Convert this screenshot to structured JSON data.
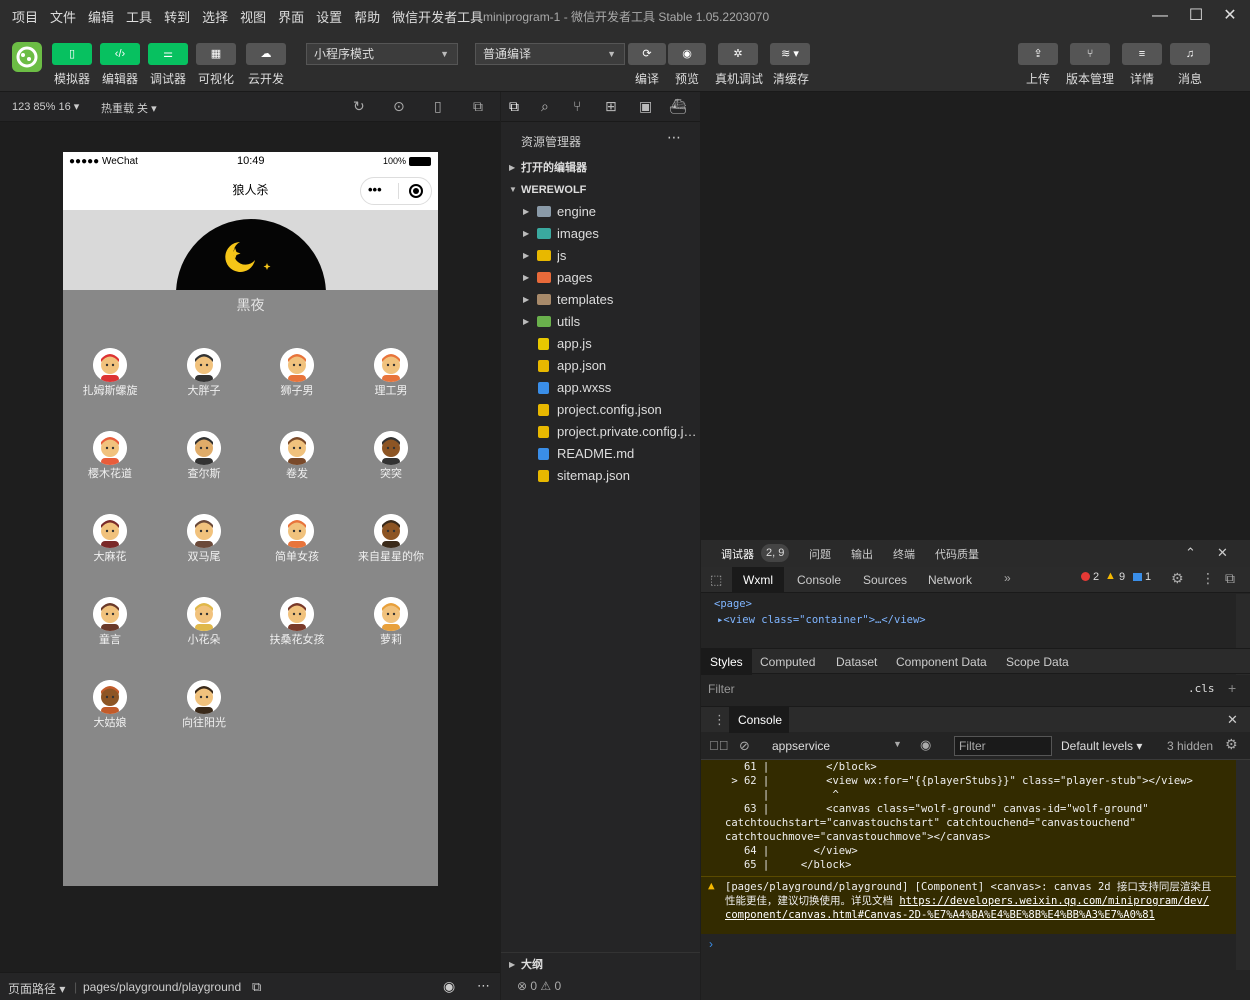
{
  "menu": [
    "项目",
    "文件",
    "编辑",
    "工具",
    "转到",
    "选择",
    "视图",
    "界面",
    "设置",
    "帮助",
    "微信开发者工具"
  ],
  "window_title": "miniprogram-1 - 微信开发者工具 Stable 1.05.2203070",
  "toolbar": {
    "simulator": "模拟器",
    "editor": "编辑器",
    "debugger": "调试器",
    "visual": "可视化",
    "cloud": "云开发",
    "mode": "小程序模式",
    "compile_mode": "普通编译",
    "compile": "编译",
    "preview": "预览",
    "remote_debug": "真机调试",
    "clear_cache": "清缓存",
    "upload": "上传",
    "version": "版本管理",
    "details": "详情",
    "messages": "消息"
  },
  "simbar": {
    "zoom": "123 85% 16 ▾",
    "hotreload": "热重载 关 ▾"
  },
  "phone": {
    "carrier": "●●●●● WeChat",
    "time": "10:49",
    "battery": "100%",
    "title": "狼人杀",
    "phase": "黑夜",
    "players": [
      {
        "name": "扎姆斯螺旋",
        "skin": "#f1c27d",
        "hair": "#d33"
      },
      {
        "name": "大胖子",
        "skin": "#f1c27d",
        "hair": "#333"
      },
      {
        "name": "狮子男",
        "skin": "#f1c27d",
        "hair": "#e8743b"
      },
      {
        "name": "理工男",
        "skin": "#f1c27d",
        "hair": "#e8743b"
      },
      {
        "name": "樱木花道",
        "skin": "#f1c27d",
        "hair": "#e85d3b"
      },
      {
        "name": "查尔斯",
        "skin": "#e0ac69",
        "hair": "#333"
      },
      {
        "name": "卷发",
        "skin": "#f1c27d",
        "hair": "#7a4a2a"
      },
      {
        "name": "突突",
        "skin": "#8d5524",
        "hair": "#333"
      },
      {
        "name": "大麻花",
        "skin": "#f1c27d",
        "hair": "#7a2a2a"
      },
      {
        "name": "双马尾",
        "skin": "#f1c27d",
        "hair": "#6b4a3a"
      },
      {
        "name": "简单女孩",
        "skin": "#f1c27d",
        "hair": "#e8743b"
      },
      {
        "name": "来自星星的你",
        "skin": "#8d5524",
        "hair": "#3a2a1a"
      },
      {
        "name": "童言",
        "skin": "#f1c27d",
        "hair": "#6b3a2a"
      },
      {
        "name": "小花朵",
        "skin": "#f1c27d",
        "hair": "#e0b84a"
      },
      {
        "name": "扶桑花女孩",
        "skin": "#f1c27d",
        "hair": "#7a3a2a"
      },
      {
        "name": "萝莉",
        "skin": "#f1c27d",
        "hair": "#e8a03b"
      },
      {
        "name": "大姑娘",
        "skin": "#8d5524",
        "hair": "#c25b2a"
      },
      {
        "name": "向往阳光",
        "skin": "#f1c27d",
        "hair": "#3a2a1a"
      }
    ]
  },
  "simfoot": {
    "path_label": "页面路径 ▾",
    "path": "pages/playground/playground"
  },
  "explorer": {
    "title": "资源管理器",
    "open_editors": "打开的编辑器",
    "root": "WEREWOLF",
    "outline": "大纲",
    "status": "⊗ 0 ⚠ 0",
    "items": [
      {
        "name": "engine",
        "type": "folder",
        "color": "#8a9aa8"
      },
      {
        "name": "images",
        "type": "folder",
        "color": "#3aa99f"
      },
      {
        "name": "js",
        "type": "folder",
        "color": "#e8b800"
      },
      {
        "name": "pages",
        "type": "folder",
        "color": "#e86a3a"
      },
      {
        "name": "templates",
        "type": "folder",
        "color": "#a88a6a"
      },
      {
        "name": "utils",
        "type": "folder",
        "color": "#6ab04c"
      },
      {
        "name": "app.js",
        "type": "file",
        "color": "#e8c800"
      },
      {
        "name": "app.json",
        "type": "file",
        "color": "#e8b800"
      },
      {
        "name": "app.wxss",
        "type": "file",
        "color": "#3a8ee8"
      },
      {
        "name": "project.config.json",
        "type": "file",
        "color": "#e8b800"
      },
      {
        "name": "project.private.config.js...",
        "type": "file",
        "color": "#e8b800"
      },
      {
        "name": "README.md",
        "type": "file",
        "color": "#3a8ee8"
      },
      {
        "name": "sitemap.json",
        "type": "file",
        "color": "#e8b800"
      }
    ]
  },
  "devtools": {
    "tabs": [
      "调试器",
      "问题",
      "输出",
      "终端",
      "代码质量"
    ],
    "badge": "2, 9",
    "subtabs": [
      "Wxml",
      "Console",
      "Sources",
      "Network"
    ],
    "errors": "2",
    "warnings": "9",
    "infos": "1",
    "wxml_line1": "<page>",
    "wxml_line2": "▸<view class=\"container\">…</view>",
    "style_tabs": [
      "Styles",
      "Computed",
      "Dataset",
      "Component Data",
      "Scope Data"
    ],
    "filter": "Filter",
    "cls": ".cls",
    "console_title": "Console",
    "context": "appservice",
    "console_filter": "Filter",
    "levels": "Default levels ▾",
    "hidden": "3 hidden",
    "log": [
      "   61 |         </block>",
      " > 62 |         <view wx:for=\"{{playerStubs}}\" class=\"player-stub\"></view>",
      "      |          ^",
      "   63 |         <canvas class=\"wolf-ground\" canvas-id=\"wolf-ground\"",
      "catchtouchstart=\"canvastouchstart\" catchtouchend=\"canvastouchend\"",
      "catchtouchmove=\"canvastouchmove\"></canvas>",
      "   64 |       </view>",
      "   65 |     </block>"
    ],
    "warn_text": "[pages/playground/playground] [Component] <canvas>: canvas 2d 接口支持同层渲染且性能更佳，建议切换使用。详见文档",
    "warn_link": "https://developers.weixin.qq.com/miniprogram/dev/component/canvas.html#Canvas-2D-%E7%A4%BA%E4%BE%8B%E4%BB%A3%E7%A0%81"
  }
}
